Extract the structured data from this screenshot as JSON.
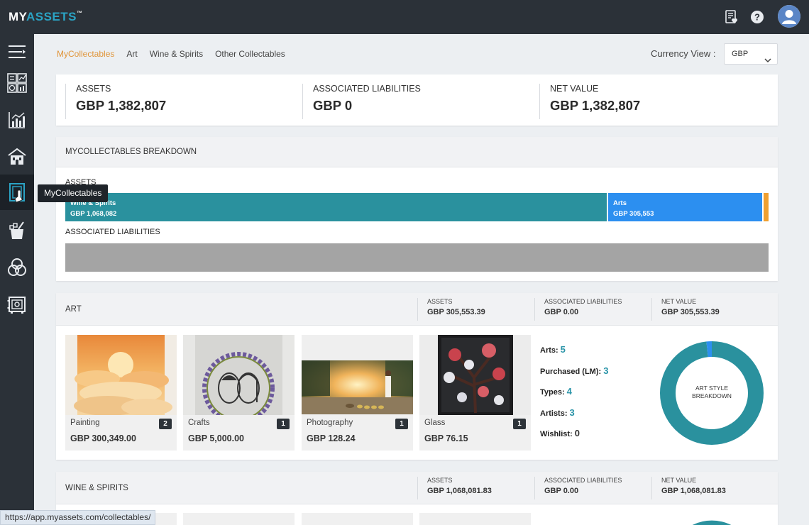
{
  "app": {
    "logo_my": "MY",
    "logo_assets": "ASSETS",
    "logo_tm": "™"
  },
  "top_icons": [
    "report-heart-icon",
    "help-icon",
    "user-avatar-icon"
  ],
  "sidebar": {
    "items": [
      "menu-expand-icon",
      "dashboard-icon",
      "investments-icon",
      "property-icon",
      "collectables-icon",
      "wine-spirits-icon",
      "other-collectables-icon",
      "safe-icon"
    ],
    "active_index": 4,
    "tooltip": "MyCollectables"
  },
  "subnav": {
    "items": [
      "MyCollectables",
      "Art",
      "Wine & Spirits",
      "Other Collectables"
    ],
    "active": "MyCollectables"
  },
  "currency": {
    "label": "Currency View :",
    "selected": "GBP"
  },
  "summary": {
    "assets_label": "ASSETS",
    "assets_value": "GBP 1,382,807",
    "liabilities_label": "ASSOCIATED LIABILITIES",
    "liabilities_value": "GBP 0",
    "net_label": "NET VALUE",
    "net_value": "GBP 1,382,807"
  },
  "breakdown": {
    "title": "MYCOLLECTABLES BREAKDOWN",
    "assets_label": "ASSETS",
    "liabilities_label": "ASSOCIATED LIABILITIES",
    "segments": [
      {
        "name": "Wine & Spirits",
        "value": "GBP 1,068,082",
        "share": 0.7724,
        "color": "#2a919e"
      },
      {
        "name": "Arts",
        "value": "GBP 305,553",
        "share": 0.221,
        "color": "#2c8ff0"
      },
      {
        "name": "",
        "value": "",
        "share": 0.0066,
        "color": "#f0a030"
      }
    ]
  },
  "art": {
    "title": "ART",
    "assets_label": "ASSETS",
    "assets_value": "GBP 305,553.39",
    "liabilities_label": "ASSOCIATED LIABILITIES",
    "liabilities_value": "GBP 0.00",
    "net_label": "NET VALUE",
    "net_value": "GBP 305,553.39",
    "tiles": [
      {
        "name": "Painting",
        "price": "GBP 300,349.00",
        "count": "2"
      },
      {
        "name": "Crafts",
        "price": "GBP 5,000.00",
        "count": "1"
      },
      {
        "name": "Photography",
        "price": "GBP 128.24",
        "count": "1"
      },
      {
        "name": "Glass",
        "price": "GBP 76.15",
        "count": "1"
      }
    ],
    "stats": [
      {
        "label": "Arts:",
        "value": "5"
      },
      {
        "label": "Purchased (LM):",
        "value": "3"
      },
      {
        "label": "Types:",
        "value": "4"
      },
      {
        "label": "Artists:",
        "value": "3"
      },
      {
        "label": "Wishlist:",
        "value": "0"
      }
    ],
    "donut_label_1": "ART STYLE",
    "donut_label_2": "BREAKDOWN",
    "donut_shares": [
      0.983,
      0.017
    ],
    "donut_colors": [
      "#2a919e",
      "#2c8ff0"
    ]
  },
  "wine": {
    "title": "WINE & SPIRITS",
    "assets_label": "ASSETS",
    "assets_value": "GBP 1,068,081.83",
    "liabilities_label": "ASSOCIATED LIABILITIES",
    "liabilities_value": "GBP 0.00",
    "net_label": "NET VALUE",
    "net_value": "GBP 1,068,081.83"
  },
  "status_url": "https://app.myassets.com/collectables/"
}
